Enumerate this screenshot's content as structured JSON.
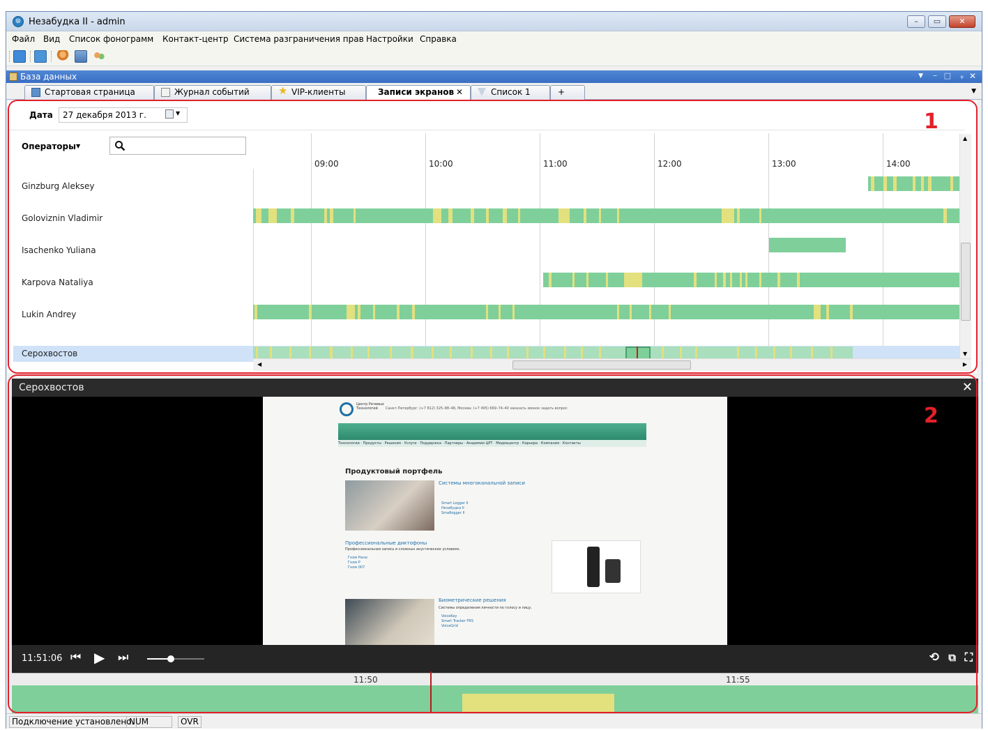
{
  "window": {
    "title": "Незабудка II - admin",
    "minimize": "–",
    "maximize": "▭",
    "close": "✕"
  },
  "menu": [
    "Файл",
    "Вид",
    "Список фонограмм",
    "Контакт-центр",
    "Система разграничения прав",
    "Настройки",
    "Справка"
  ],
  "dock": {
    "title": "База данных"
  },
  "tabs": [
    {
      "label": "Стартовая страница"
    },
    {
      "label": "Журнал событий"
    },
    {
      "label": "VIP-клиенты"
    },
    {
      "label": "Записи экранов",
      "active": true,
      "close": "✕"
    },
    {
      "label": "Список 1"
    },
    {
      "label": "+"
    }
  ],
  "filters": {
    "date_label": "Дата",
    "date_value": "27 декабря  2013 г.",
    "operators_label": "Операторы",
    "search_placeholder": ""
  },
  "timeline": {
    "hours": [
      "09:00",
      "10:00",
      "11:00",
      "12:00",
      "13:00",
      "14:00"
    ],
    "operators": [
      {
        "name": "Ginzburg Aleksey"
      },
      {
        "name": "Goloviznin Vladimir"
      },
      {
        "name": "Isachenko Yuliana"
      },
      {
        "name": "Karpova Nataliya"
      },
      {
        "name": "Lukin Andrey"
      },
      {
        "name": "Серохвостов",
        "selected": true
      }
    ]
  },
  "annotations": {
    "panel1": "1",
    "panel2": "2"
  },
  "player": {
    "title": "Серохвостов",
    "close": "✕",
    "time": "11:51:06",
    "volume": 0.42,
    "mini_timeline": {
      "ticks": [
        "11:50",
        "11:55"
      ],
      "cursor_time": "11:51:06"
    }
  },
  "screen": {
    "header": "Санкт-Петербург: (+7 812) 325–88–48, Москва: (+7 495) 669–74–40   заказать звонок   задать вопрос",
    "logo": "Центр Речевых Технологий",
    "nav": [
      "Технологии",
      "Продукты",
      "Решения",
      "Услуги",
      "Поддержка",
      "Партнеры",
      "Академия ЦРТ",
      "Медиацентр",
      "Карьера",
      "Компания",
      "Контакты"
    ],
    "page_title": "Продуктовый портфель",
    "section1_title": "Системы многоканальной записи",
    "section1_items": [
      "Smart Logger II",
      "Незабудка II",
      "SmaRogger II"
    ],
    "section2_title": "Профессиональные диктофоны",
    "section2_sub": "Профессиональная запись в сложных акустических условиях.",
    "section2_items": [
      "Гном Нано",
      "Гном Р",
      "Гном 007"
    ],
    "section3_title": "Биометрические решения",
    "section3_sub": "Системы определения личности по голосу и лицу.",
    "section3_items": [
      "VoiceKey",
      "Smart Tracker FRS",
      "VoiceGrid"
    ]
  },
  "status": {
    "connection": "Подключение установлено.",
    "num": "NUM",
    "ovr": "OVR"
  },
  "colors": {
    "activity_green": "#7fcf9b",
    "activity_yellow": "#e3e07e",
    "selection_row": "#cfe2f7",
    "frame_red": "#e3202a"
  }
}
